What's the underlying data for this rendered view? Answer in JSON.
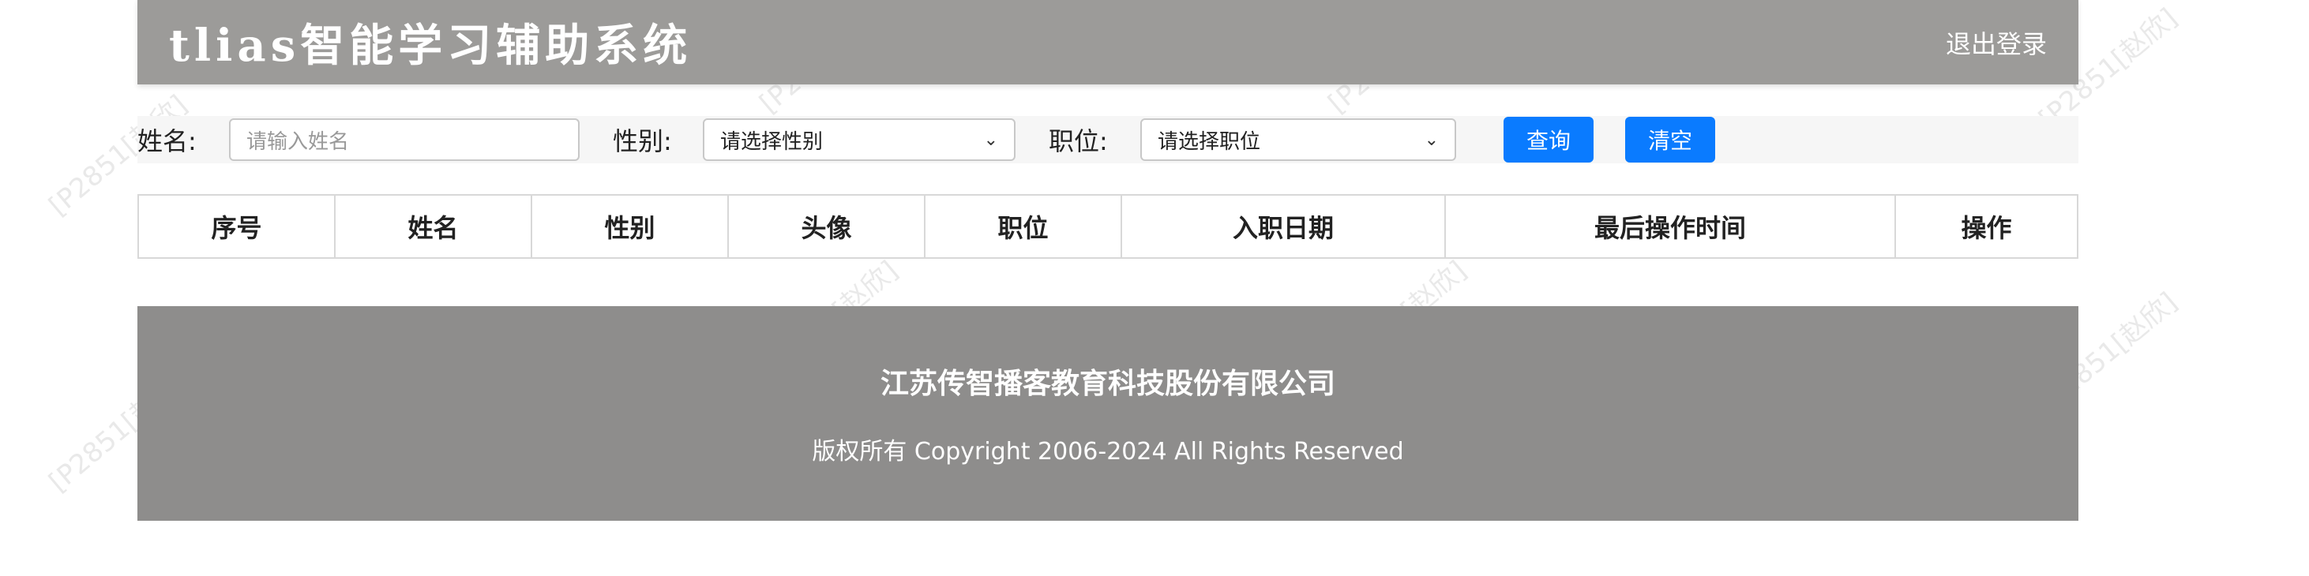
{
  "header": {
    "title": "tlias智能学习辅助系统",
    "logout_label": "退出登录"
  },
  "search": {
    "name_label": "姓名:",
    "name_placeholder": "请输入姓名",
    "gender_label": "性别:",
    "gender_value": "请选择性别",
    "job_label": "职位:",
    "job_value": "请选择职位",
    "query_label": "查询",
    "clear_label": "清空"
  },
  "table": {
    "columns": [
      "序号",
      "姓名",
      "性别",
      "头像",
      "职位",
      "入职日期",
      "最后操作时间",
      "操作"
    ]
  },
  "footer": {
    "company": "江苏传智播客教育科技股份有限公司",
    "copyright": "版权所有 Copyright 2006-2024 All Rights Reserved"
  },
  "watermark": {
    "text": "[P2851[赵欣]"
  },
  "colors": {
    "header_bg": "#9c9b99",
    "footer_bg": "#8e8d8c",
    "button_bg": "#0a7bff"
  },
  "icons": {
    "select_arrow": "chevron-down-icon"
  }
}
